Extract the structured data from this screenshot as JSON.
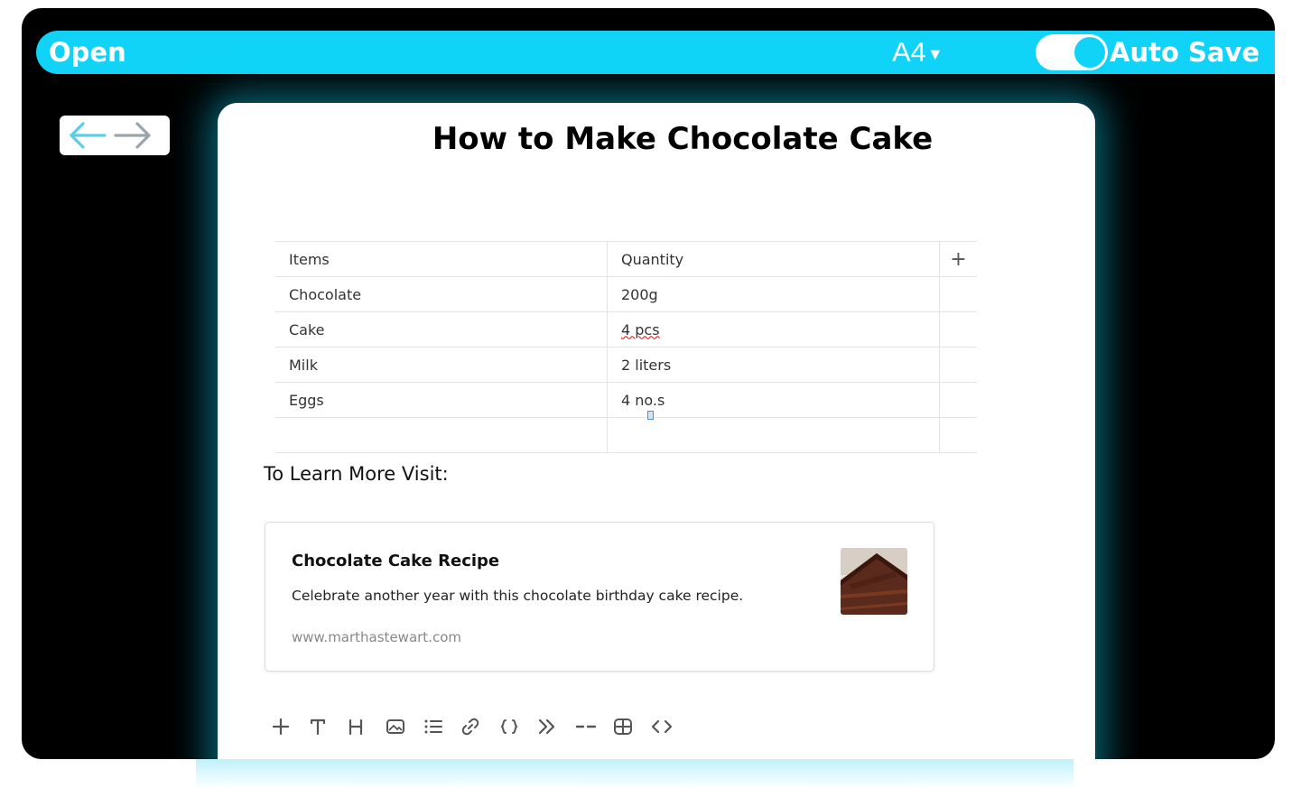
{
  "topbar": {
    "open_label": "Open",
    "page_size": "A4",
    "autosave_label": "Auto Save",
    "autosave_on": true,
    "accent_color": "#10d3f7"
  },
  "nav": {
    "back_icon": "arrow-left-icon",
    "forward_icon": "arrow-right-icon"
  },
  "document": {
    "title": "How to Make Chocolate Cake",
    "table": {
      "headers": [
        "Items",
        "Quantity"
      ],
      "add_column_label": "+",
      "rows": [
        [
          "Chocolate",
          "200g"
        ],
        [
          "Cake",
          "4 pcs"
        ],
        [
          "Milk",
          "2 liters"
        ],
        [
          "Eggs",
          "4 no.s"
        ],
        [
          "",
          ""
        ]
      ]
    },
    "learn_more": "To Learn More Visit:",
    "link_card": {
      "title": "Chocolate Cake Recipe",
      "description": "Celebrate another year with this chocolate birthday cake recipe.",
      "url": "www.marthastewart.com",
      "thumbnail": "chocolate-cake-slice-image"
    }
  },
  "toolbar": {
    "tools": [
      "add-block-icon",
      "text-icon",
      "heading-icon",
      "image-icon",
      "list-icon",
      "link-icon",
      "code-icon",
      "quote-icon",
      "divider-icon",
      "table-icon",
      "embed-icon"
    ]
  }
}
